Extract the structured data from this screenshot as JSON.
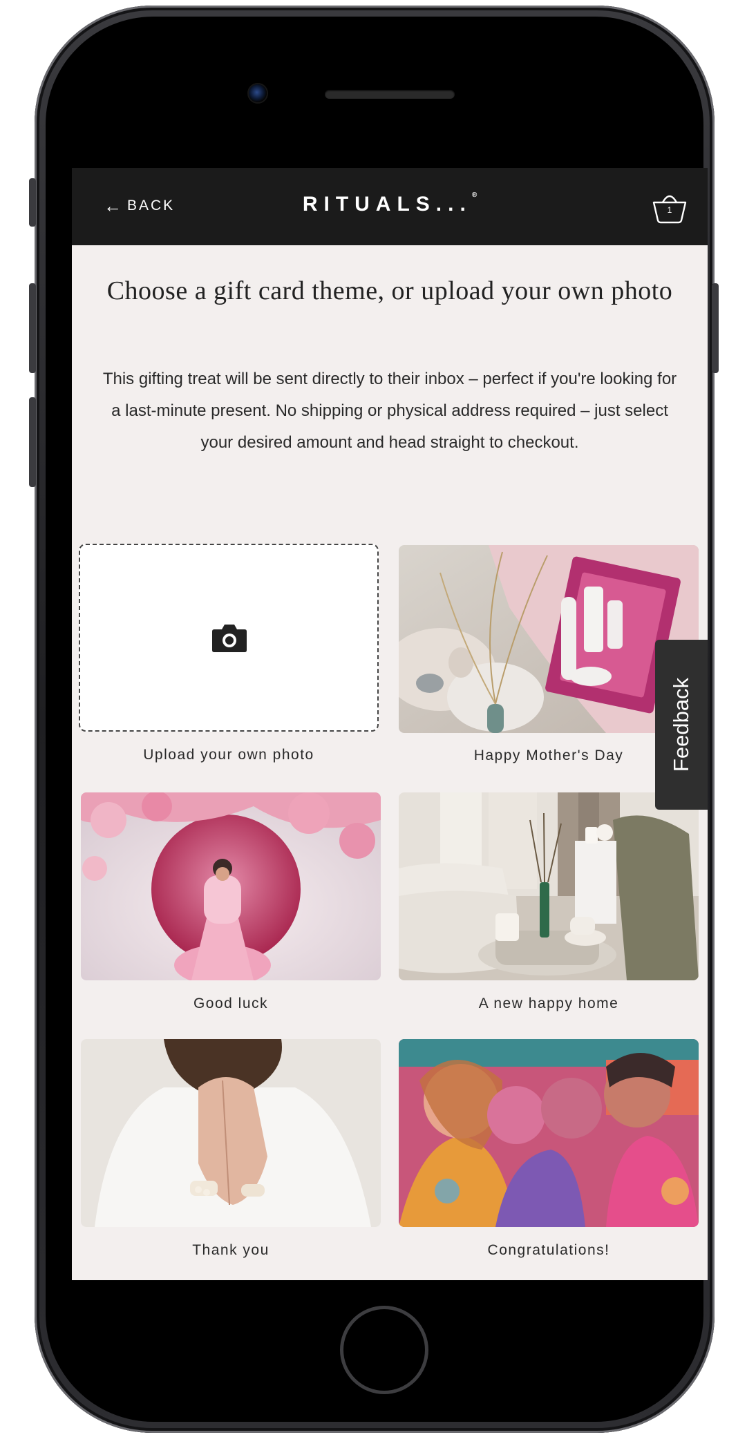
{
  "nav": {
    "back_label": "BACK",
    "brand": "RITUALS...",
    "brand_mark": "®",
    "cart_count": "1"
  },
  "page": {
    "title": "Choose a gift card theme, or upload your own photo",
    "description": "This gifting treat will be sent directly to their inbox – perfect if you're looking for a last-minute present. No shipping or physical address required – just select your desired amount and head straight to checkout."
  },
  "themes": [
    {
      "label": "Upload your own photo",
      "icon": "camera-icon"
    },
    {
      "label": "Happy Mother's Day"
    },
    {
      "label": "Good luck"
    },
    {
      "label": "A new happy home"
    },
    {
      "label": "Thank you"
    },
    {
      "label": "Congratulations!"
    }
  ],
  "feedback": {
    "label": "Feedback"
  },
  "colors": {
    "nav_bg": "#1b1b1b",
    "page_bg": "#f3efee",
    "text": "#222222",
    "feedback_bg": "#2f2f2f"
  }
}
